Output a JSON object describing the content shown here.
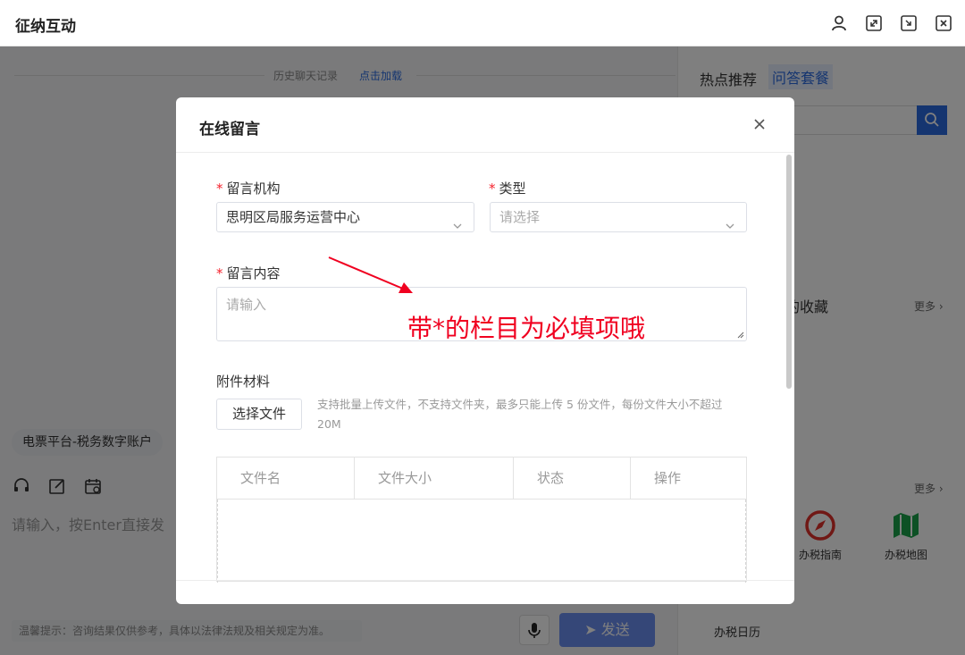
{
  "window": {
    "title": "征纳互动",
    "icons": [
      "user-icon",
      "expand-icon",
      "minimize-to-panel-icon",
      "close-window-icon"
    ]
  },
  "chat": {
    "history_text": "历史聊天记录",
    "history_link": "点击加载",
    "chip": "电票平台-税务数字账户",
    "input_placeholder": "请输入，按Enter直接发",
    "tip": "温馨提示：咨询结果仅供参考，具体以法律法规及相关规定为准。",
    "send_label": "发送"
  },
  "sidebar": {
    "tab_hot": "热点推荐",
    "tab_qa": "问答套餐",
    "favorites_fragment": "的收藏",
    "more_1": "更多 ›",
    "more_2": "更多 ›",
    "services": [
      {
        "label": "办税指南",
        "icon": "compass-icon",
        "color": "#e0312b"
      },
      {
        "label": "办税地图",
        "icon": "map-icon",
        "color": "#1aa34a"
      }
    ],
    "calendar_label": "办税日历"
  },
  "modal": {
    "title": "在线留言",
    "fields": {
      "org_label": "留言机构",
      "org_value": "思明区局服务运营中心",
      "type_label": "类型",
      "type_placeholder": "请选择",
      "content_label": "留言内容",
      "content_placeholder": "请输入",
      "attach_label": "附件材料",
      "upload_button": "选择文件",
      "upload_hint": "支持批量上传文件，不支持文件夹，最多只能上传 5 份文件，每份文件大小不超过20M",
      "required_mark": "*"
    },
    "file_table": {
      "columns": [
        "文件名",
        "文件大小",
        "状态",
        "操作"
      ]
    },
    "annotation": "带*的栏目为必填项哦"
  },
  "colors": {
    "accent": "#2a6ae0",
    "required": "#f5222d",
    "annotation": "#f00020",
    "send_button": "#6b8ef0"
  }
}
